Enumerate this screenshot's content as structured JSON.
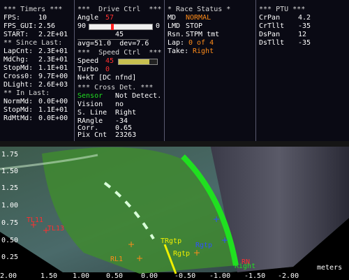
{
  "timers": {
    "header": "*** Timers ***",
    "fps_label": "FPS:",
    "fps_value": "10",
    "fps_gui_label": "FPS_GUI:",
    "fps_gui_value": "2.56",
    "start_label": "START:",
    "start_value": "2.2E+01",
    "since_header": "** Since Last:",
    "lapcnt_label": "LapCnt:",
    "lapcnt_value": "2.3E+01",
    "mdchg_label": "MdChg:",
    "mdchg_value": "2.3E+01",
    "stopmd_label": "StopMd:",
    "stopmd_value": "1.1E+01",
    "cross0_label": "Cross0:",
    "cross0_value": "9.7E+00",
    "dlight_label": "DLight:",
    "dlight_value": "2.6E+03",
    "inlast_header": "** In Last:",
    "normmd_label": "NormMd:",
    "normmd_value": "0.0E+00",
    "stopmd2_label": "StopMd:",
    "stopmd2_value": "1.1E+01",
    "rdmtmd_label": "RdMtMd:",
    "rdmtmd_value": "0.0E+00"
  },
  "drive": {
    "header": "***  Drive Ctrl  ***",
    "angle_label": "Angle",
    "angle_value": "57",
    "bar_left": "90",
    "bar_right": "0",
    "bar_mid": "45",
    "angle_fraction": 0.367,
    "avg_text": "avg=51.0  dev=7.6",
    "speed_header": "***  Speed Ctrl  ***",
    "speed_label": "Speed",
    "speed_value": "45",
    "speed_fraction": 0.8,
    "turbo_label": "Turbo",
    "turbo_value": "0",
    "nkt_text": "N+kT [DC nfnd]",
    "cross_header": "*** Cross Det. ***",
    "sensor_label": "Sensor",
    "sensor_value": "Not Detect.",
    "vision_label": "Vision",
    "vision_value": "no",
    "sline_label": "S. Line",
    "sline_value": "Right",
    "rangle_label": "RAngle",
    "rangle_value": "-34",
    "corr_label": "Corr.",
    "corr_value": "0.65",
    "pixcnt_label": "Pix Cnt",
    "pixcnt_value": "23263"
  },
  "race": {
    "header": "* Race Status *",
    "md_label": "MD",
    "md_value": "NORMAL",
    "lmd_label": "LMD",
    "lmd_value": "STOP",
    "rsn_label": "Rsn.",
    "rsn_value": "STPM tmt",
    "lap_label": "Lap:",
    "lap_value": "0 of 4",
    "take_label": "Take:",
    "take_value": "Right"
  },
  "ptu": {
    "header": "*** PTU ***",
    "crpan_label": "CrPan",
    "crpan_value": "4.2",
    "crtilt_label": "CrTllt",
    "crtilt_value": "-35",
    "dspan_label": "DsPan",
    "dspan_value": "12",
    "dstilt_label": "DsTllt",
    "dstilt_value": "-35"
  },
  "scene": {
    "y_ticks": [
      "1.75",
      "1.50",
      "1.25",
      "1.00",
      "0.75",
      "0.50",
      "0.25"
    ],
    "x_ticks": [
      "2.00",
      "1.50",
      "1.00",
      "0.50",
      "0.00",
      "-0.50",
      "-1.00",
      "-1.50",
      "-2.00"
    ],
    "x_unit": "meters",
    "labels": {
      "tl11": "TL11",
      "tl13": "TL13",
      "rl1": "RL1",
      "trgtp": "TRgtp",
      "rgtp": "Rgtp",
      "rgtp2": "Rgtp",
      "rn": "RN",
      "right": "Right"
    },
    "colors": {
      "accent_green": "#20e020",
      "warning_red": "#ff3030",
      "orange": "#ff8c1a",
      "yellow": "#f0f000",
      "blue": "#3050ff"
    }
  }
}
